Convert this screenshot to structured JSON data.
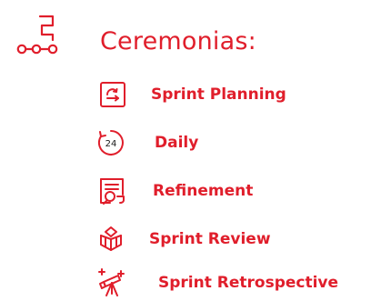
{
  "colors": {
    "accent": "#e01e2b"
  },
  "header": {
    "icon": "workflow-steps-icon",
    "title": "Ceremonias:"
  },
  "ceremonies": [
    {
      "icon": "sprint-planning-icon",
      "label": "Sprint Planning"
    },
    {
      "icon": "clock-24-icon",
      "clock_text": "24",
      "label": "Daily"
    },
    {
      "icon": "document-search-icon",
      "label": "Refinement"
    },
    {
      "icon": "gift-box-icon",
      "label": "Sprint Review"
    },
    {
      "icon": "telescope-icon",
      "label": "Sprint Retrospective"
    }
  ]
}
